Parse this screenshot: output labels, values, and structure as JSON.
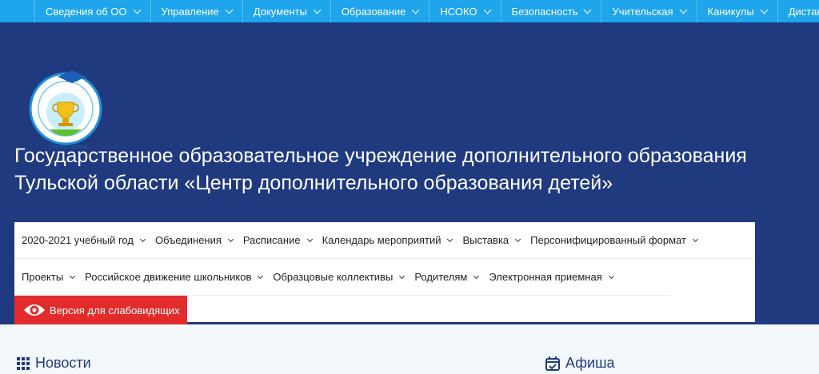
{
  "topnav": {
    "items": [
      {
        "label": "Сведения об ОО"
      },
      {
        "label": "Управление"
      },
      {
        "label": "Документы"
      },
      {
        "label": "Образование"
      },
      {
        "label": "НСОКО"
      },
      {
        "label": "Безопасность"
      },
      {
        "label": "Учительская"
      },
      {
        "label": "Каникулы"
      },
      {
        "label": "Дистант"
      }
    ]
  },
  "header": {
    "title_line1": "Государственное образовательное учреждение дополнительного образования",
    "title_line2": "Тульской области «Центр дополнительного образования детей»"
  },
  "menu": {
    "row1": [
      {
        "label": "2020-2021 учебный год"
      },
      {
        "label": "Объединения"
      },
      {
        "label": "Расписание"
      },
      {
        "label": "Календарь мероприятий"
      },
      {
        "label": "Выставка"
      },
      {
        "label": "Персонифицированный формат"
      }
    ],
    "row2": [
      {
        "label": "Проекты"
      },
      {
        "label": "Российское движение школьников"
      },
      {
        "label": "Образцовые коллективы"
      },
      {
        "label": "Родителям"
      },
      {
        "label": "Электронная приемная"
      }
    ]
  },
  "low_vision": {
    "label": "Версия для слабовидящих"
  },
  "sections": {
    "news": {
      "title": "Новости"
    },
    "afisha": {
      "title": "Афиша"
    }
  },
  "colors": {
    "topnav_bg": "#1ea5ec",
    "header_bg": "#203a80",
    "low_vision_bg": "#e22c2c",
    "section_title": "#203a80"
  },
  "icons": {
    "topnav_dropdown": "chevron-down-icon",
    "low_vision": "eye-icon",
    "news": "grid-icon",
    "afisha": "calendar-check-icon"
  }
}
